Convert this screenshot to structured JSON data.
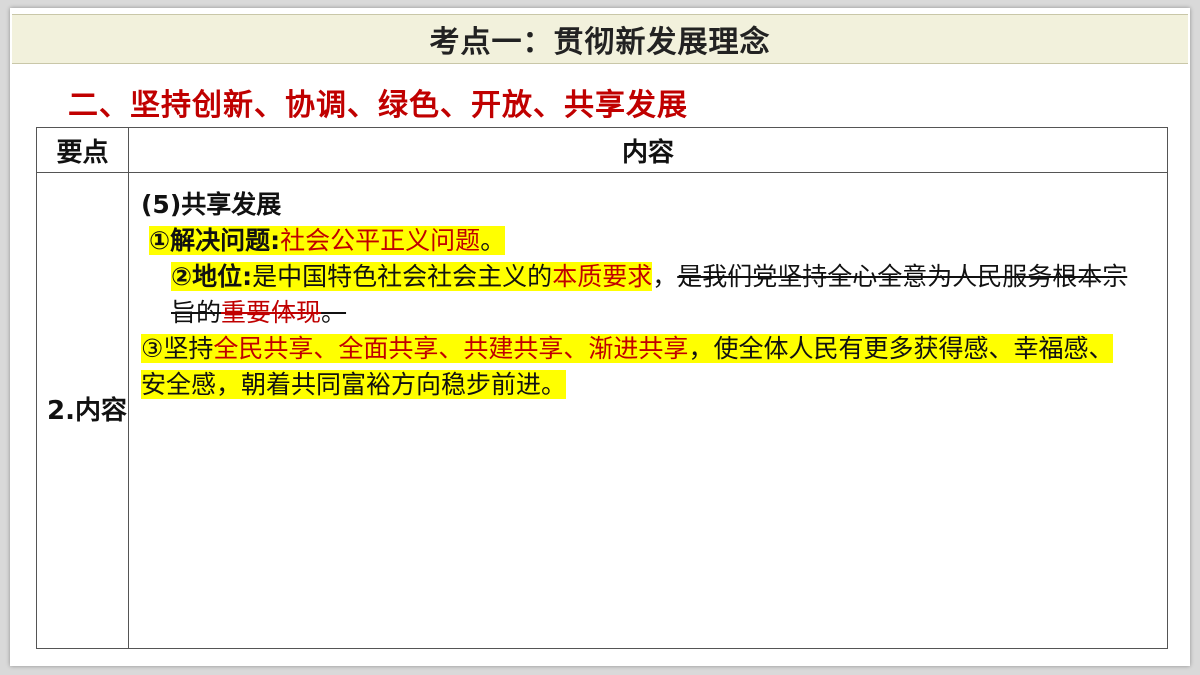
{
  "header": {
    "title": "考点一：贯彻新发展理念"
  },
  "subtitle": "二、坚持创新、协调、绿色、开放、共享发展",
  "table": {
    "headers": [
      "要点",
      "内容"
    ],
    "row_label": "2.内容",
    "content": {
      "heading": "(5)共享发展",
      "item1_label": "①解决问题:",
      "item1_text": "社会公平正义问题",
      "item1_end": "。",
      "item2_label": "②地位:",
      "item2_text_a": "是中国特色社会社会主义的",
      "item2_text_red": "本质要求",
      "item2_comma": "，",
      "item2_strike_a": "是我们党坚持全心全意为人民服务根本宗旨的",
      "item2_strike_red": "重要体现",
      "item2_strike_end": "。",
      "item3_prefix": "③坚持",
      "item3_red": "全民共享、全面共享、共建共享、渐进共享",
      "item3_rest": "，使全体人民有更多获得感、幸福感、安全感，朝着共同富裕方向稳步前进。"
    }
  },
  "colors": {
    "title_bg": "#f2f1dc",
    "accent_red": "#c00000",
    "highlight": "#ffff00"
  }
}
